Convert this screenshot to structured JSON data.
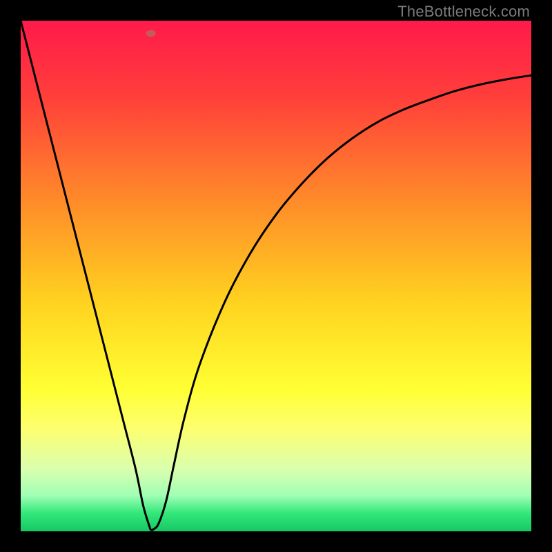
{
  "watermark": "TheBottleneck.com",
  "chart_data": {
    "type": "line",
    "title": "",
    "xlabel": "",
    "ylabel": "",
    "xlim": [
      0,
      1
    ],
    "ylim": [
      0,
      1
    ],
    "grid": false,
    "background_gradient": {
      "stops": [
        {
          "offset": 0.0,
          "color": "#ff1a4b"
        },
        {
          "offset": 0.15,
          "color": "#ff3f3a"
        },
        {
          "offset": 0.35,
          "color": "#ff8a2a"
        },
        {
          "offset": 0.55,
          "color": "#ffd21f"
        },
        {
          "offset": 0.72,
          "color": "#ffff33"
        },
        {
          "offset": 0.8,
          "color": "#fdff70"
        },
        {
          "offset": 0.88,
          "color": "#d9ffb0"
        },
        {
          "offset": 0.93,
          "color": "#9fffb4"
        },
        {
          "offset": 0.965,
          "color": "#32e77a"
        },
        {
          "offset": 1.0,
          "color": "#17c765"
        }
      ]
    },
    "marker": {
      "x": 0.255,
      "y": 0.975,
      "color": "#c45a5a"
    },
    "series": [
      {
        "name": "curve",
        "color": "#000000",
        "points": [
          {
            "x": 0.0,
            "y": 1.0
          },
          {
            "x": 0.05,
            "y": 0.805
          },
          {
            "x": 0.1,
            "y": 0.61
          },
          {
            "x": 0.15,
            "y": 0.415
          },
          {
            "x": 0.2,
            "y": 0.22
          },
          {
            "x": 0.225,
            "y": 0.122
          },
          {
            "x": 0.24,
            "y": 0.05
          },
          {
            "x": 0.252,
            "y": 0.01
          },
          {
            "x": 0.255,
            "y": 0.003
          },
          {
            "x": 0.26,
            "y": 0.004
          },
          {
            "x": 0.27,
            "y": 0.015
          },
          {
            "x": 0.285,
            "y": 0.06
          },
          {
            "x": 0.3,
            "y": 0.13
          },
          {
            "x": 0.32,
            "y": 0.22
          },
          {
            "x": 0.35,
            "y": 0.325
          },
          {
            "x": 0.4,
            "y": 0.45
          },
          {
            "x": 0.45,
            "y": 0.545
          },
          {
            "x": 0.5,
            "y": 0.62
          },
          {
            "x": 0.55,
            "y": 0.68
          },
          {
            "x": 0.6,
            "y": 0.73
          },
          {
            "x": 0.65,
            "y": 0.77
          },
          {
            "x": 0.7,
            "y": 0.802
          },
          {
            "x": 0.75,
            "y": 0.826
          },
          {
            "x": 0.8,
            "y": 0.845
          },
          {
            "x": 0.85,
            "y": 0.862
          },
          {
            "x": 0.9,
            "y": 0.875
          },
          {
            "x": 0.95,
            "y": 0.885
          },
          {
            "x": 1.0,
            "y": 0.893
          }
        ]
      }
    ]
  }
}
